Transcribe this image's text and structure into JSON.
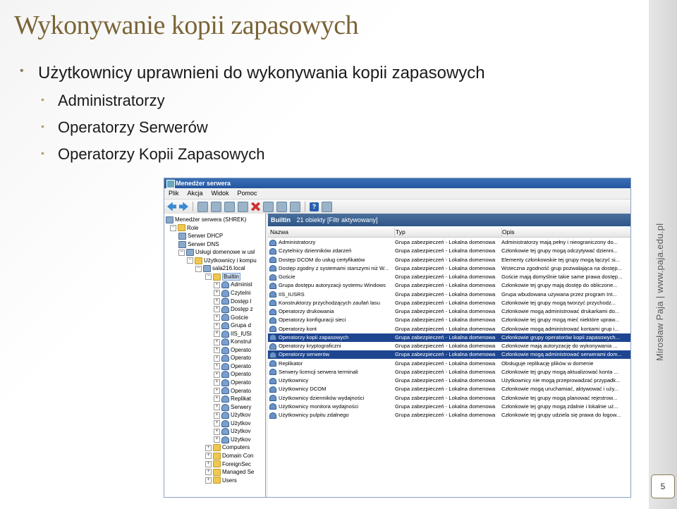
{
  "slide": {
    "title": "Wykonywanie kopii zapasowych",
    "bullet_main": "Użytkownicy uprawnieni do wykonywania kopii zapasowych",
    "sub_bullets": [
      "Administratorzy",
      "Operatorzy Serwerów",
      "Operatorzy Kopii Zapasowych"
    ],
    "credit": "Mirosław Paja | www.paja.edu.pl",
    "page_number": "5"
  },
  "window": {
    "title": "Menedżer serwera",
    "menu": [
      "Plik",
      "Akcja",
      "Widok",
      "Pomoc"
    ],
    "toolbar_icons": [
      "back-arrow-icon",
      "forward-arrow-icon",
      "up-folder-icon",
      "tree-toggle-icon",
      "cut-icon",
      "copy-icon",
      "delete-icon",
      "properties-icon",
      "refresh-icon",
      "export-icon",
      "help-icon",
      "filter-icon"
    ]
  },
  "tree": {
    "items": [
      {
        "label": "Menedżer serwera (SHREK)",
        "icon": "server"
      },
      {
        "label": "Role",
        "icon": "folder"
      },
      {
        "label": "Serwer DHCP",
        "icon": "server"
      },
      {
        "label": "Serwer DNS",
        "icon": "server"
      },
      {
        "label": "Usługi domenowe w usł",
        "icon": "server"
      },
      {
        "label": "Użytkownicy i kompu",
        "icon": "folder"
      },
      {
        "label": "sala216.local",
        "icon": "server"
      },
      {
        "label": "Builtin",
        "icon": "folder"
      },
      {
        "label": "Administ",
        "icon": "group"
      },
      {
        "label": "Czytelni",
        "icon": "group"
      },
      {
        "label": "Dostęp l",
        "icon": "group"
      },
      {
        "label": "Dostęp z",
        "icon": "group"
      },
      {
        "label": "Goście",
        "icon": "group"
      },
      {
        "label": "Grupa d",
        "icon": "group"
      },
      {
        "label": "IIS_IUSI",
        "icon": "group"
      },
      {
        "label": "Konstrul",
        "icon": "group"
      },
      {
        "label": "Operato",
        "icon": "group"
      },
      {
        "label": "Operato",
        "icon": "group"
      },
      {
        "label": "Operato",
        "icon": "group"
      },
      {
        "label": "Operato",
        "icon": "group"
      },
      {
        "label": "Operato",
        "icon": "group"
      },
      {
        "label": "Operato",
        "icon": "group"
      },
      {
        "label": "Replikat",
        "icon": "group"
      },
      {
        "label": "Serwery",
        "icon": "group"
      },
      {
        "label": "Użytkov",
        "icon": "group"
      },
      {
        "label": "Użytkov",
        "icon": "group"
      },
      {
        "label": "Użytkov",
        "icon": "group"
      },
      {
        "label": "Użytkov",
        "icon": "group"
      },
      {
        "label": "Computers",
        "icon": "folder"
      },
      {
        "label": "Domain Con",
        "icon": "folder"
      },
      {
        "label": "ForeignSec",
        "icon": "folder"
      },
      {
        "label": "Managed Se",
        "icon": "folder"
      },
      {
        "label": "Users",
        "icon": "folder"
      }
    ]
  },
  "content": {
    "header_name": "Builtin",
    "header_count": "21 obiekty [Filtr aktywowany]",
    "columns": [
      "Nazwa",
      "Typ",
      "Opis"
    ],
    "rows": [
      {
        "name": "Administratorzy",
        "type": "Grupa zabezpieczeń - Lokalna domenowa",
        "desc": "Administratorzy mają pełny i nieograniczony do..."
      },
      {
        "name": "Czytelnicy dzienników zdarzeń",
        "type": "Grupa zabezpieczeń - Lokalna domenowa",
        "desc": "Członkowie tej grupy mogą odczytywać dzienni..."
      },
      {
        "name": "Dostęp DCOM do usług certyfikatów",
        "type": "Grupa zabezpieczeń - Lokalna domenowa",
        "desc": "Elementy członkowskie tej grupy mogą łączyć si..."
      },
      {
        "name": "Dostęp zgodny z systemami starszymi niż W...",
        "type": "Grupa zabezpieczeń - Lokalna domenowa",
        "desc": "Wsteczna zgodność grup pozwalająca na dostęp..."
      },
      {
        "name": "Goście",
        "type": "Grupa zabezpieczeń - Lokalna domenowa",
        "desc": "Goście mają domyślnie takie same prawa dostęp..."
      },
      {
        "name": "Grupa dostępu autoryzacji systemu Windows",
        "type": "Grupa zabezpieczeń - Lokalna domenowa",
        "desc": "Członkowie tej grupy mają dostęp do obliczone..."
      },
      {
        "name": "IIS_IUSRS",
        "type": "Grupa zabezpieczeń - Lokalna domenowa",
        "desc": "Grupa wbudowana używana przez program Int..."
      },
      {
        "name": "Konstruktorzy przychodzących zaufań lasu",
        "type": "Grupa zabezpieczeń - Lokalna domenowa",
        "desc": "Członkowie tej grupy mogą tworzyć przychodz..."
      },
      {
        "name": "Operatorzy drukowania",
        "type": "Grupa zabezpieczeń - Lokalna domenowa",
        "desc": "Członkowie mogą administrować drukarkami do..."
      },
      {
        "name": "Operatorzy konfiguracji sieci",
        "type": "Grupa zabezpieczeń - Lokalna domenowa",
        "desc": "Członkowie tej grupy mogą mieć niektóre upraw..."
      },
      {
        "name": "Operatorzy kont",
        "type": "Grupa zabezpieczeń - Lokalna domenowa",
        "desc": "Członkowie mogą administrować kontami grup i..."
      },
      {
        "name": "Operatorzy kopii zapasowych",
        "type": "Grupa zabezpieczeń - Lokalna domenowa",
        "desc": "Członkowie grupy operatorów kopii zapasowych..."
      },
      {
        "name": "Operatorzy kryptograficzni",
        "type": "Grupa zabezpieczeń - Lokalna domenowa",
        "desc": "Członkowie mają autoryzację do wykonywania ..."
      },
      {
        "name": "Operatorzy serwerów",
        "type": "Grupa zabezpieczeń - Lokalna domenowa",
        "desc": "Członkowie mogą administrować serwerami dom..."
      },
      {
        "name": "Replikator",
        "type": "Grupa zabezpieczeń - Lokalna domenowa",
        "desc": "Obsługuje replikację plików w domenie"
      },
      {
        "name": "Serwery licencji serwera terminali",
        "type": "Grupa zabezpieczeń - Lokalna domenowa",
        "desc": "Członkowie tej grupy mogą aktualizować konta ..."
      },
      {
        "name": "Użytkownicy",
        "type": "Grupa zabezpieczeń - Lokalna domenowa",
        "desc": "Użytkownicy nie mogą przeprowadzać przypadk..."
      },
      {
        "name": "Użytkownicy DCOM",
        "type": "Grupa zabezpieczeń - Lokalna domenowa",
        "desc": "Członkowie mogą uruchamiać, aktywować i uży..."
      },
      {
        "name": "Użytkownicy dzienników wydajności",
        "type": "Grupa zabezpieczeń - Lokalna domenowa",
        "desc": "Członkowie tej grupy mogą planować rejestrow..."
      },
      {
        "name": "Użytkownicy monitora wydajności",
        "type": "Grupa zabezpieczeń - Lokalna domenowa",
        "desc": "Członkowie tej grupy mogą zdalnie i lokalnie uż..."
      },
      {
        "name": "Użytkownicy pulpitu zdalnego",
        "type": "Grupa zabezpieczeń - Lokalna domenowa",
        "desc": "Członkowie tej grupy udziela się prawa do logow..."
      }
    ],
    "selected_rows": [
      11,
      13
    ]
  }
}
